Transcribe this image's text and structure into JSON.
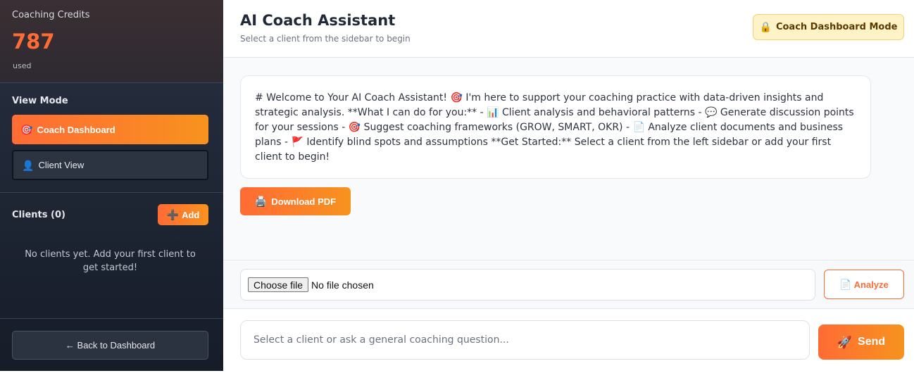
{
  "sidebar": {
    "credits": {
      "label": "Coaching Credits",
      "value": "787",
      "sub": "used"
    },
    "view_mode": {
      "title": "View Mode",
      "coach_label": "Coach Dashboard",
      "coach_icon": "target-icon",
      "client_label": "Client View",
      "client_icon": "person-icon"
    },
    "clients": {
      "title": "Clients (0)",
      "add_label": "Add",
      "empty_text": "No clients yet. Add your first client to get started!"
    },
    "back_label": "← Back to Dashboard"
  },
  "header": {
    "title": "AI Coach Assistant",
    "subtitle": "Select a client from the sidebar to begin",
    "mode_badge": "Coach Dashboard Mode"
  },
  "message": {
    "text": "# Welcome to Your AI Coach Assistant! 🎯 I'm here to support your coaching practice with data-driven insights and strategic analysis. **What I can do for you:** - 📊 Client analysis and behavioral patterns - 💬 Generate discussion points for your sessions - 🎯 Suggest coaching frameworks (GROW, SMART, OKR) - 📄 Analyze client documents and business plans - 🚩 Identify blind spots and assumptions **Get Started:** Select a client from the left sidebar or add your first client to begin!"
  },
  "pdf_button": "Download PDF",
  "upload": {
    "choose_label": "Choose file",
    "status": "No file chosen",
    "analyze_label": "Analyze"
  },
  "chat": {
    "placeholder": "Select a client or ask a general coaching question...",
    "send_label": "Send"
  },
  "colors": {
    "accent": "#ff6b35",
    "accent2": "#f7931e",
    "sidebar_bg": "#1e2533",
    "badge_bg": "#fdf3c7"
  }
}
